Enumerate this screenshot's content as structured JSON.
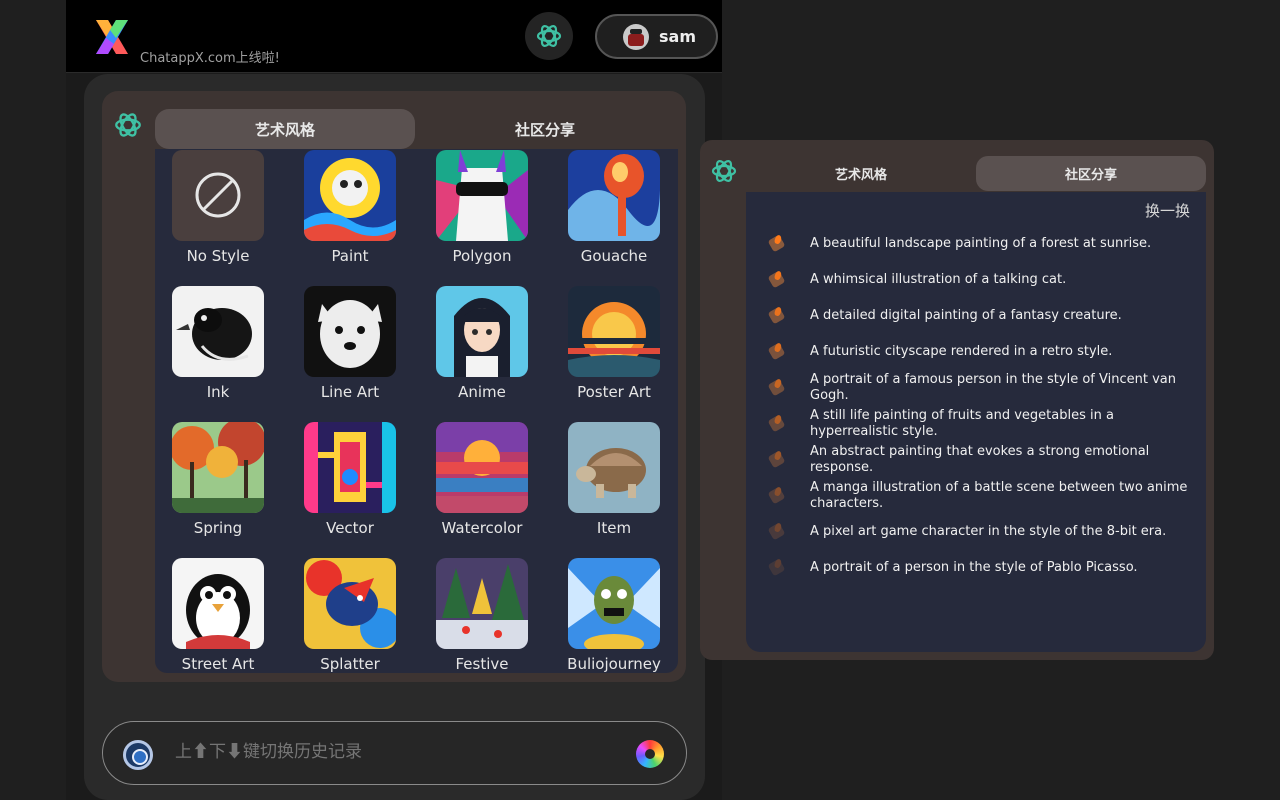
{
  "header": {
    "logo_text": "ChatappX.com上线啦!",
    "user_name": "sam"
  },
  "style_card": {
    "tabs": [
      {
        "label": "艺术风格",
        "active": true
      },
      {
        "label": "社区分享",
        "active": false
      }
    ],
    "styles": [
      {
        "label": "No Style",
        "icon": "no-style-icon"
      },
      {
        "label": "Paint",
        "icon": "paint-thumb"
      },
      {
        "label": "Polygon",
        "icon": "polygon-thumb"
      },
      {
        "label": "Gouache",
        "icon": "gouache-thumb"
      },
      {
        "label": "Ink",
        "icon": "ink-thumb"
      },
      {
        "label": "Line Art",
        "icon": "line-art-thumb"
      },
      {
        "label": "Anime",
        "icon": "anime-thumb"
      },
      {
        "label": "Poster Art",
        "icon": "poster-art-thumb"
      },
      {
        "label": "Spring",
        "icon": "spring-thumb"
      },
      {
        "label": "Vector",
        "icon": "vector-thumb"
      },
      {
        "label": "Watercolor",
        "icon": "watercolor-thumb"
      },
      {
        "label": "Item",
        "icon": "item-thumb"
      },
      {
        "label": "Street Art",
        "icon": "street-art-thumb"
      },
      {
        "label": "Splatter",
        "icon": "splatter-thumb"
      },
      {
        "label": "Festive",
        "icon": "festive-thumb"
      },
      {
        "label": "Buliojourney",
        "icon": "buliojourney-thumb"
      }
    ]
  },
  "input": {
    "placeholder": "上⬆下⬇键切换历史记录"
  },
  "community": {
    "tabs": [
      {
        "label": "艺术风格",
        "active": false
      },
      {
        "label": "社区分享",
        "active": true
      }
    ],
    "refresh_label": "换一换",
    "prompts": [
      "A beautiful landscape painting of a forest at sunrise.",
      "A whimsical illustration of a talking cat.",
      "A detailed digital painting of a fantasy creature.",
      "A futuristic cityscape rendered in a retro style.",
      "A portrait of a famous person in the style of Vincent van Gogh.",
      "A still life painting of fruits and vegetables in a hyperrealistic style.",
      "An abstract painting that evokes a strong emotional response.",
      "A manga illustration of a battle scene between two anime characters.",
      "A pixel art game character in the style of the 8-bit era.",
      "A portrait of a person in the style of Pablo Picasso."
    ]
  }
}
